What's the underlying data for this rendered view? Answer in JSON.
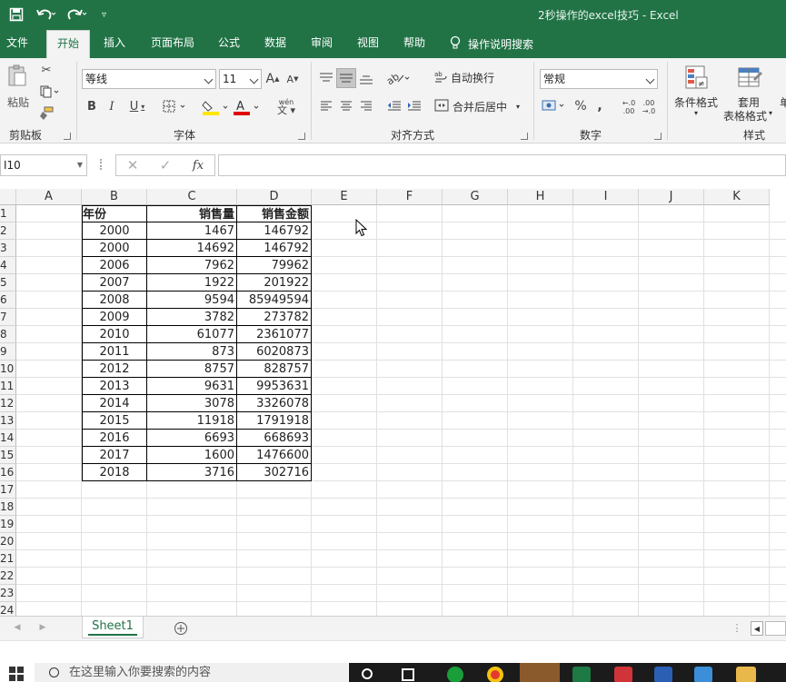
{
  "window": {
    "title": "2秒操作的excel技巧 - Excel"
  },
  "tabs": [
    "文件",
    "开始",
    "插入",
    "页面布局",
    "公式",
    "数据",
    "审阅",
    "视图",
    "帮助"
  ],
  "tell_me": "操作说明搜索",
  "ribbon": {
    "clipboard": {
      "paste": "粘贴",
      "label": "剪贴板"
    },
    "font": {
      "name": "等线",
      "size": "11",
      "label": "字体",
      "phonetic": "wén"
    },
    "alignment": {
      "wrap": "自动换行",
      "merge": "合并后居中",
      "label": "对齐方式"
    },
    "number": {
      "format": "常规",
      "label": "数字"
    },
    "styles": {
      "cond_format": "条件格式",
      "table_format_1": "套用",
      "table_format_2": "表格格式",
      "label": "样式",
      "cell_partial": "单"
    }
  },
  "formula_bar": {
    "name_box": "I10",
    "fx": "fx"
  },
  "columns": [
    "A",
    "B",
    "C",
    "D",
    "E",
    "F",
    "G",
    "H",
    "I",
    "J",
    "K"
  ],
  "row_numbers": [
    "1",
    "2",
    "3",
    "4",
    "5",
    "6",
    "7",
    "8",
    "9",
    "10",
    "11",
    "12",
    "13",
    "14",
    "15",
    "16",
    "17",
    "18",
    "19",
    "20",
    "21",
    "22",
    "23",
    "24"
  ],
  "table": {
    "headers": [
      "年份",
      "销售量",
      "销售金额"
    ],
    "rows": [
      [
        "2000",
        "1467",
        "146792"
      ],
      [
        "2000",
        "14692",
        "146792"
      ],
      [
        "2006",
        "7962",
        "79962"
      ],
      [
        "2007",
        "1922",
        "201922"
      ],
      [
        "2008",
        "9594",
        "85949594"
      ],
      [
        "2009",
        "3782",
        "273782"
      ],
      [
        "2010",
        "61077",
        "2361077"
      ],
      [
        "2011",
        "873",
        "6020873"
      ],
      [
        "2012",
        "8757",
        "828757"
      ],
      [
        "2013",
        "9631",
        "9953631"
      ],
      [
        "2014",
        "3078",
        "3326078"
      ],
      [
        "2015",
        "11918",
        "1791918"
      ],
      [
        "2016",
        "6693",
        "668693"
      ],
      [
        "2017",
        "1600",
        "1476600"
      ],
      [
        "2018",
        "3716",
        "302716"
      ]
    ]
  },
  "sheet_tabs": [
    "Sheet1"
  ],
  "taskbar": {
    "search_placeholder": "在这里输入你要搜索的内容"
  }
}
